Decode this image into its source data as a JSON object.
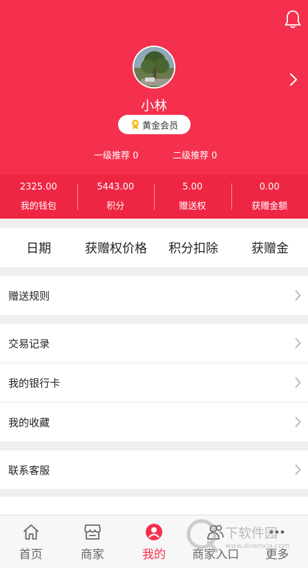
{
  "profile": {
    "username": "小林",
    "level": "黄金会员",
    "referral_level1": "一级推荐 0",
    "referral_level2": "二级推荐 0"
  },
  "stats": [
    {
      "value": "2325.00",
      "label": "我的钱包"
    },
    {
      "value": "5443.00",
      "label": "积分"
    },
    {
      "value": "5.00",
      "label": "赠送权"
    },
    {
      "value": "0.00",
      "label": "获赠金额"
    }
  ],
  "table_headers": [
    "日期",
    "获赠权价格",
    "积分扣除",
    "获赠金"
  ],
  "menu": {
    "gift_rules": "赠送规则",
    "transactions": "交易记录",
    "bank_cards": "我的银行卡",
    "favorites": "我的收藏",
    "support": "联系客服"
  },
  "tabs": [
    {
      "label": "首页",
      "icon": "home-icon"
    },
    {
      "label": "商家",
      "icon": "store-icon"
    },
    {
      "label": "我的",
      "icon": "user-icon",
      "active": true
    },
    {
      "label": "商家入口",
      "icon": "merchant-entry-icon"
    },
    {
      "label": "更多",
      "icon": "more-icon"
    }
  ],
  "watermark": {
    "text": "下软件园",
    "url": "www.downxia.com"
  },
  "colors": {
    "header": "#f5304f",
    "stats_bar": "#ee2644",
    "active_tab": "#f5304f"
  }
}
